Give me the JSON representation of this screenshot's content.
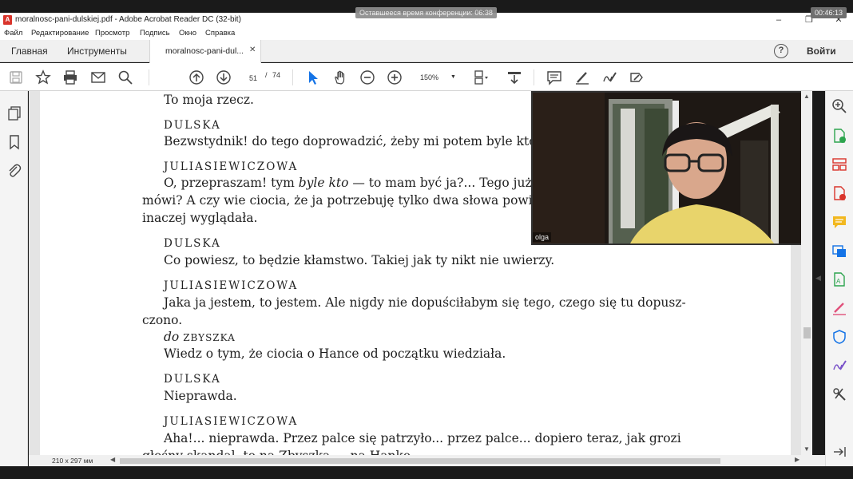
{
  "topbar": {
    "conference_timer": "Оставшееся время конференции: 06:38",
    "clock": "00:46:13"
  },
  "window": {
    "title": "moralnosc-pani-dulskiej.pdf - Adobe Acrobat Reader DC (32-bit)",
    "minimize": "–",
    "maximize": "❐",
    "close": "✕"
  },
  "menu": [
    "Файл",
    "Редактирование",
    "Просмотр",
    "Подпись",
    "Окно",
    "Справка"
  ],
  "tabs": {
    "home": "Главная",
    "tools": "Инструменты",
    "document": "moralnosc-pani-dul...",
    "close": "✕"
  },
  "account": {
    "help": "?",
    "signin": "Войти"
  },
  "toolbar": {
    "page_current": "51",
    "page_sep": "/",
    "page_total": "74",
    "zoom": "150%",
    "zoom_arrow": "▼"
  },
  "document": {
    "lines": [
      "To moja rzecz.",
      "DULSKA",
      "Bezwstydnik! do tego doprowadzić, żeby mi potem byle kto oczy",
      "JULIASIEWICZOWA",
      "O, przepraszam! tym ",
      "byle kto",
      " — to mam być ja?... Tego już zanad",
      "mówi? A czy wie ciocia, że ja potrzebuję tylko dwa słowa powiedzieć, ab",
      "inaczej wyglądała.",
      "DULSKA",
      "Co powiesz, to będzie kłamstwo. Takiej jak ty nikt nie uwierzy.",
      "JULIASIEWICZOWA",
      "Jaka ja jestem, to jestem. Ale nigdy nie dopuściłabym się tego, czego się tu dopusz-",
      "czono.",
      "do",
      "ZBYSZKA",
      "Wiedz o tym, że ciocia o Hance od początku wiedziała.",
      "DULSKA",
      "Nieprawda.",
      "JULIASIEWICZOWA",
      "Aha!... nieprawda. Przez palce się patrzyło... przez palce... dopiero teraz, jak grozi",
      "głośny skandal, to na Zbyszka — na Hankę"
    ]
  },
  "status": {
    "page_size": "210 x 297 мм"
  },
  "video": {
    "participant": "olga"
  },
  "colors": {
    "accent_blue": "#1473e6",
    "red_icon": "#d9342b",
    "pink": "#e0507a",
    "purple": "#7a53c9",
    "yellow": "#f2b81f",
    "green": "#2da44e"
  }
}
